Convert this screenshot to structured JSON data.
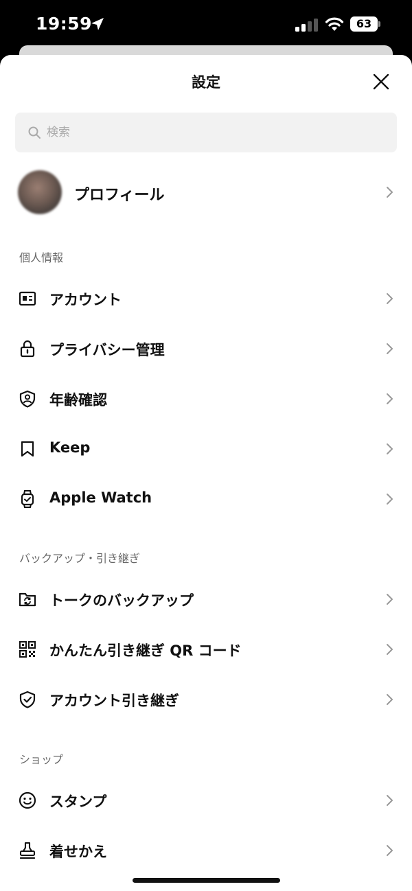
{
  "status": {
    "time": "19:59",
    "battery": "63"
  },
  "header": {
    "title": "設定"
  },
  "search": {
    "placeholder": "検索"
  },
  "profile": {
    "label": "プロフィール"
  },
  "sections": {
    "personal": "個人情報",
    "backup": "バックアップ・引き継ぎ",
    "shop": "ショップ"
  },
  "items": {
    "account": {
      "label": "アカウント",
      "icon": "id-card-icon"
    },
    "privacy": {
      "label": "プライバシー管理",
      "icon": "lock-icon"
    },
    "age": {
      "label": "年齢確認",
      "icon": "shield-person-icon"
    },
    "keep": {
      "label": "Keep",
      "icon": "bookmark-icon"
    },
    "watch": {
      "label": "Apple Watch",
      "icon": "watch-icon"
    },
    "talk_backup": {
      "label": "トークのバックアップ",
      "icon": "folder-sync-icon"
    },
    "qr_transfer": {
      "label": "かんたん引き継ぎ QR コード",
      "icon": "qr-code-icon"
    },
    "account_transfer": {
      "label": "アカウント引き継ぎ",
      "icon": "shield-check-icon"
    },
    "stickers": {
      "label": "スタンプ",
      "icon": "smiley-icon"
    },
    "themes": {
      "label": "着せかえ",
      "icon": "stamp-icon"
    }
  }
}
